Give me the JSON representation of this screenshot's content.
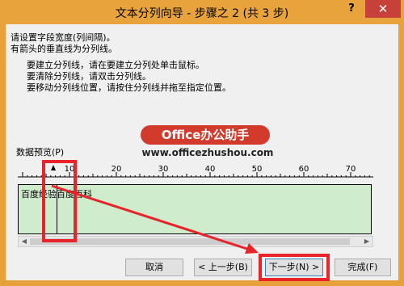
{
  "window": {
    "title": "文本分列向导 - 步骤之 2 (共 3 步)",
    "help_label": "?",
    "close_label": "✕"
  },
  "instructions": {
    "line1": "请设置字段宽度(列间隔)。",
    "line2": "有箭头的垂直线为分列线。",
    "line3": "要建立分列线，请在要建立分列处单击鼠标。",
    "line4": "要清除分列线，请双击分列线。",
    "line5": "要移动分列线位置，请按住分列线并拖至指定位置。"
  },
  "watermark": {
    "badge": "Office办公助手",
    "url": "www.officezhushou.com"
  },
  "preview": {
    "label": "数据预览(P)",
    "ruler_ticks": [
      "10",
      "20",
      "30",
      "40",
      "50",
      "60",
      "70"
    ],
    "row_text": "百度经验百度百科"
  },
  "buttons": {
    "cancel": "取消",
    "back": "< 上一步(B)",
    "next": "下一步(N) >",
    "finish": "完成(F)"
  },
  "colors": {
    "titlebar": "#e8a33c",
    "close": "#c7413a",
    "preview_bg": "#cfeccd",
    "highlight": "#e8232a",
    "watermark": "#d23b2c"
  }
}
